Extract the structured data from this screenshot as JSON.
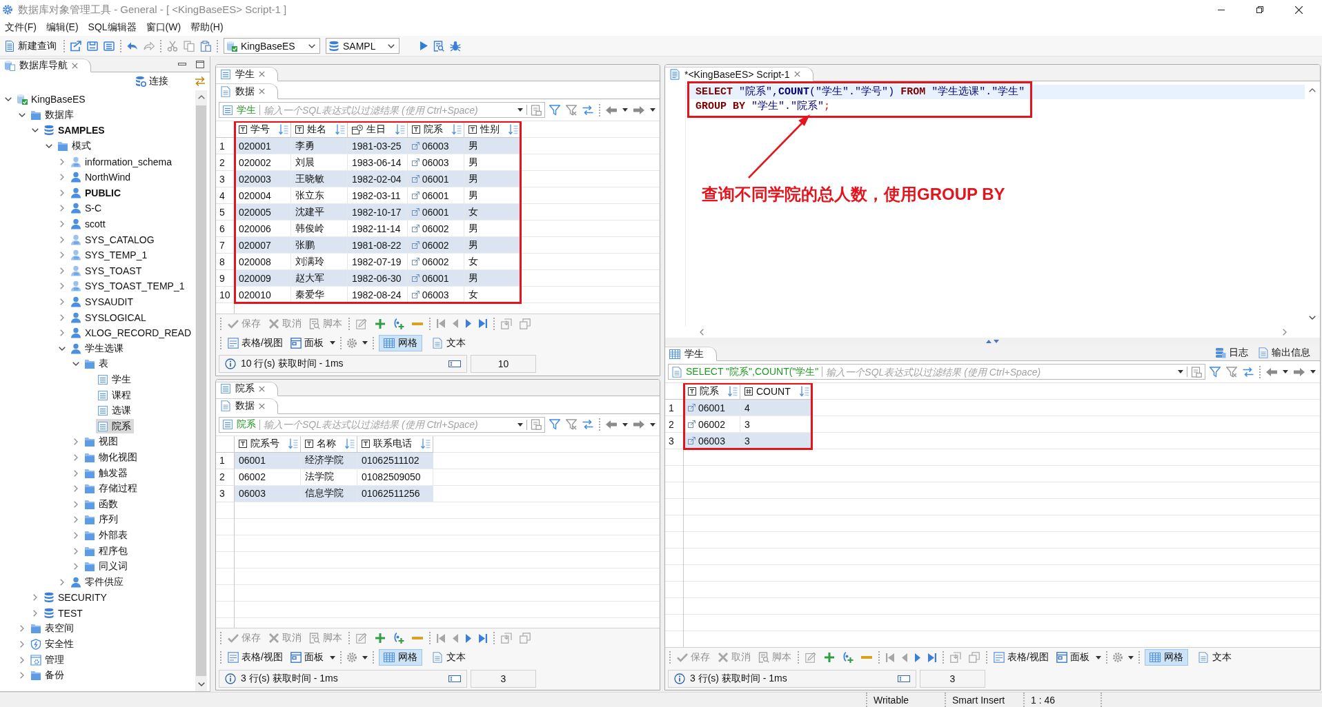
{
  "window": {
    "title": "数据库对象管理工具 - General - [ <KingBaseES> Script-1 ]"
  },
  "menu": [
    "文件(F)",
    "编辑(E)",
    "SQL编辑器",
    "窗口(W)",
    "帮助(H)"
  ],
  "toolbar": {
    "new_query": "新建查询",
    "tools": [
      [
        {
          "kind": "export",
          "disabled": false
        },
        {
          "kind": "save",
          "disabled": false
        },
        {
          "kind": "save-all",
          "disabled": false
        }
      ],
      [
        {
          "kind": "undo",
          "disabled": false
        },
        {
          "kind": "redo",
          "disabled": true
        }
      ],
      [
        {
          "kind": "cut",
          "disabled": true
        },
        {
          "kind": "copy",
          "disabled": true
        },
        {
          "kind": "paste",
          "disabled": false
        }
      ]
    ],
    "connection": "KingBaseES",
    "database": "SAMPL",
    "run": [
      {
        "kind": "execute",
        "disabled": false
      },
      {
        "kind": "explain",
        "disabled": false
      },
      {
        "kind": "debug",
        "disabled": false
      }
    ]
  },
  "navigator": {
    "tab": {
      "label": "数据库导航",
      "selected": true
    },
    "connect": "连接",
    "tree": [
      {
        "label": "KingBaseES",
        "kind": "connection",
        "selected": false,
        "current": false,
        "expanded": true,
        "children": [
          {
            "label": "数据库",
            "kind": "folder",
            "selected": false,
            "current": false,
            "expanded": true,
            "children": [
              {
                "label": "SAMPLES",
                "kind": "database",
                "selected": false,
                "current": true,
                "expanded": true,
                "children": [
                  {
                    "label": "模式",
                    "kind": "folder",
                    "selected": false,
                    "current": false,
                    "expanded": true,
                    "children": [
                      {
                        "label": "information_schema",
                        "kind": "system-schema",
                        "selected": false,
                        "current": false,
                        "expanded": false
                      },
                      {
                        "label": "NorthWind",
                        "kind": "schema",
                        "selected": false,
                        "current": false,
                        "expanded": false
                      },
                      {
                        "label": "PUBLIC",
                        "kind": "schema",
                        "selected": false,
                        "current": true,
                        "expanded": false
                      },
                      {
                        "label": "S-C",
                        "kind": "schema",
                        "selected": false,
                        "current": false,
                        "expanded": false
                      },
                      {
                        "label": "scott",
                        "kind": "schema",
                        "selected": false,
                        "current": false,
                        "expanded": false
                      },
                      {
                        "label": "SYS_CATALOG",
                        "kind": "system-schema",
                        "selected": false,
                        "current": false,
                        "expanded": false
                      },
                      {
                        "label": "SYS_TEMP_1",
                        "kind": "system-schema",
                        "selected": false,
                        "current": false,
                        "expanded": false
                      },
                      {
                        "label": "SYS_TOAST",
                        "kind": "system-schema",
                        "selected": false,
                        "current": false,
                        "expanded": false
                      },
                      {
                        "label": "SYS_TOAST_TEMP_1",
                        "kind": "system-schema",
                        "selected": false,
                        "current": false,
                        "expanded": false
                      },
                      {
                        "label": "SYSAUDIT",
                        "kind": "schema",
                        "selected": false,
                        "current": false,
                        "expanded": false
                      },
                      {
                        "label": "SYSLOGICAL",
                        "kind": "schema",
                        "selected": false,
                        "current": false,
                        "expanded": false
                      },
                      {
                        "label": "XLOG_RECORD_READ",
                        "kind": "schema",
                        "selected": false,
                        "current": false,
                        "expanded": false
                      },
                      {
                        "label": "学生选课",
                        "kind": "schema",
                        "selected": false,
                        "current": false,
                        "expanded": true,
                        "children": [
                          {
                            "label": "表",
                            "kind": "folder",
                            "selected": false,
                            "current": false,
                            "expanded": true,
                            "children": [
                              {
                                "label": "学生",
                                "kind": "table",
                                "selected": false,
                                "current": false
                              },
                              {
                                "label": "课程",
                                "kind": "table",
                                "selected": false,
                                "current": false
                              },
                              {
                                "label": "选课",
                                "kind": "table",
                                "selected": false,
                                "current": false
                              },
                              {
                                "label": "院系",
                                "kind": "table",
                                "selected": true,
                                "current": false
                              }
                            ]
                          },
                          {
                            "label": "视图",
                            "kind": "folder",
                            "selected": false,
                            "current": false,
                            "expanded": false
                          },
                          {
                            "label": "物化视图",
                            "kind": "folder",
                            "selected": false,
                            "current": false,
                            "expanded": false
                          },
                          {
                            "label": "触发器",
                            "kind": "folder",
                            "selected": false,
                            "current": false,
                            "expanded": false
                          },
                          {
                            "label": "存储过程",
                            "kind": "folder",
                            "selected": false,
                            "current": false,
                            "expanded": false
                          },
                          {
                            "label": "函数",
                            "kind": "folder",
                            "selected": false,
                            "current": false,
                            "expanded": false
                          },
                          {
                            "label": "序列",
                            "kind": "folder",
                            "selected": false,
                            "current": false,
                            "expanded": false
                          },
                          {
                            "label": "外部表",
                            "kind": "folder",
                            "selected": false,
                            "current": false,
                            "expanded": false
                          },
                          {
                            "label": "程序包",
                            "kind": "folder",
                            "selected": false,
                            "current": false,
                            "expanded": false
                          },
                          {
                            "label": "同义词",
                            "kind": "folder",
                            "selected": false,
                            "current": false,
                            "expanded": false
                          }
                        ]
                      },
                      {
                        "label": "零件供应",
                        "kind": "schema",
                        "selected": false,
                        "current": false,
                        "expanded": false
                      }
                    ]
                  }
                ]
              },
              {
                "label": "SECURITY",
                "kind": "database",
                "selected": false,
                "current": false,
                "expanded": false
              },
              {
                "label": "TEST",
                "kind": "database",
                "selected": false,
                "current": false,
                "expanded": false
              }
            ]
          },
          {
            "label": "表空间",
            "kind": "folder",
            "selected": false,
            "current": false,
            "expanded": false
          },
          {
            "label": "安全性",
            "kind": "shield",
            "selected": false,
            "current": false,
            "expanded": false
          },
          {
            "label": "管理",
            "kind": "admin",
            "selected": false,
            "current": false,
            "expanded": false
          },
          {
            "label": "备份",
            "kind": "folder",
            "selected": false,
            "current": false,
            "expanded": false
          }
        ]
      }
    ]
  },
  "editors": [
    {
      "tab": {
        "label": "学生",
        "selected": true
      },
      "subtab": {
        "label": "数据",
        "selected": true
      },
      "filter": {
        "kind": "table",
        "source": "学生",
        "placeholder": "输入一个SQL表达式以过滤结果 (使用 Ctrl+Space)"
      },
      "grid": {
        "highlighted": true,
        "columns": [
          {
            "label": "学号",
            "kind": "text"
          },
          {
            "label": "姓名",
            "kind": "text"
          },
          {
            "label": "生日",
            "kind": "date"
          },
          {
            "label": "院系",
            "kind": "text",
            "link": true
          },
          {
            "label": "性别",
            "kind": "text"
          }
        ],
        "rows": [
          {
            "number": "1",
            "cells": [
              "020001",
              "李勇",
              "1981-03-25",
              "06003",
              "男"
            ]
          },
          {
            "number": "2",
            "cells": [
              "020002",
              "刘晨",
              "1983-06-14",
              "06003",
              "男"
            ]
          },
          {
            "number": "3",
            "cells": [
              "020003",
              "王晓敏",
              "1982-02-04",
              "06001",
              "男"
            ]
          },
          {
            "number": "4",
            "cells": [
              "020004",
              "张立东",
              "1982-03-11",
              "06001",
              "男"
            ]
          },
          {
            "number": "5",
            "cells": [
              "020005",
              "沈建平",
              "1982-10-17",
              "06001",
              "女"
            ]
          },
          {
            "number": "6",
            "cells": [
              "020006",
              "韩俊岭",
              "1982-11-14",
              "06002",
              "男"
            ]
          },
          {
            "number": "7",
            "cells": [
              "020007",
              "张鹏",
              "1981-08-22",
              "06002",
              "男"
            ]
          },
          {
            "number": "8",
            "cells": [
              "020008",
              "刘满玲",
              "1982-07-19",
              "06002",
              "女"
            ]
          },
          {
            "number": "9",
            "cells": [
              "020009",
              "赵大军",
              "1982-06-30",
              "06001",
              "男"
            ]
          },
          {
            "number": "10",
            "cells": [
              "020010",
              "秦爱华",
              "1982-08-24",
              "06003",
              "女"
            ]
          }
        ]
      },
      "actions": [
        [
          {
            "kind": "save",
            "label": "保存",
            "disabled": true
          },
          {
            "kind": "cancel",
            "label": "取消",
            "disabled": true
          },
          {
            "kind": "script",
            "label": "脚本",
            "disabled": true
          }
        ],
        [
          {
            "kind": "edit",
            "disabled": true
          },
          {
            "kind": "add",
            "disabled": false
          },
          {
            "kind": "duplicate",
            "disabled": false
          },
          {
            "kind": "delete",
            "disabled": false
          }
        ],
        [
          {
            "kind": "first",
            "disabled": true
          },
          {
            "kind": "previous",
            "disabled": true
          },
          {
            "kind": "next",
            "disabled": false
          },
          {
            "kind": "last",
            "disabled": false
          }
        ],
        [
          {
            "kind": "fetch-next",
            "disabled": true
          },
          {
            "kind": "fetch-all",
            "disabled": true
          }
        ]
      ],
      "views": {
        "modes": [
          {
            "kind": "record",
            "label": "表格/视图"
          },
          {
            "kind": "panels",
            "label": "面板"
          }
        ],
        "formats": [
          {
            "kind": "grid",
            "label": "网格",
            "selected": true
          },
          {
            "kind": "text",
            "label": "文本",
            "selected": false
          }
        ]
      },
      "status": {
        "text": "10 行(s) 获取时间 - 1ms",
        "count": "10"
      }
    },
    {
      "tab": {
        "label": "院系",
        "selected": true
      },
      "subtab": {
        "label": "数据",
        "selected": true
      },
      "filter": {
        "kind": "table",
        "source": "院系",
        "placeholder": "输入一个SQL表达式以过滤结果 (使用 Ctrl+Space)"
      },
      "grid": {
        "columns": [
          {
            "label": "院系号",
            "kind": "text"
          },
          {
            "label": "名称",
            "kind": "text"
          },
          {
            "label": "联系电话",
            "kind": "text"
          }
        ],
        "rows": [
          {
            "number": "1",
            "cells": [
              "06001",
              "经济学院",
              "01062511102"
            ]
          },
          {
            "number": "2",
            "cells": [
              "06002",
              "法学院",
              "01082509050"
            ]
          },
          {
            "number": "3",
            "cells": [
              "06003",
              "信息学院",
              "01062511256"
            ]
          }
        ]
      },
      "actions": [
        [
          {
            "kind": "save",
            "label": "保存",
            "disabled": true
          },
          {
            "kind": "cancel",
            "label": "取消",
            "disabled": true
          },
          {
            "kind": "script",
            "label": "脚本",
            "disabled": true
          }
        ],
        [
          {
            "kind": "edit",
            "disabled": true
          },
          {
            "kind": "add",
            "disabled": false
          },
          {
            "kind": "duplicate",
            "disabled": false
          },
          {
            "kind": "delete",
            "disabled": false
          }
        ],
        [
          {
            "kind": "first",
            "disabled": true
          },
          {
            "kind": "previous",
            "disabled": true
          },
          {
            "kind": "next",
            "disabled": false
          },
          {
            "kind": "last",
            "disabled": false
          }
        ],
        [
          {
            "kind": "fetch-next",
            "disabled": true
          },
          {
            "kind": "fetch-all",
            "disabled": true
          }
        ]
      ],
      "views": {
        "modes": [
          {
            "kind": "record",
            "label": "表格/视图"
          },
          {
            "kind": "panels",
            "label": "面板"
          }
        ],
        "formats": [
          {
            "kind": "grid",
            "label": "网格",
            "selected": true
          },
          {
            "kind": "text",
            "label": "文本",
            "selected": false
          }
        ]
      },
      "status": {
        "text": "3 行(s) 获取时间 - 1ms",
        "count": "3"
      }
    }
  ],
  "script": {
    "tab": {
      "label": "*<KingBaseES> Script-1",
      "selected": true
    },
    "highlighted": true,
    "lines": [
      {
        "current": true,
        "tokens": [
          {
            "kind": "keyword",
            "text": "SELECT "
          },
          {
            "kind": "identifier",
            "text": "\"院系\""
          },
          {
            "kind": "symbol",
            "text": ","
          },
          {
            "kind": "function",
            "text": "COUNT"
          },
          {
            "kind": "symbol",
            "text": "("
          },
          {
            "kind": "identifier",
            "text": "\"学生\""
          },
          {
            "kind": "symbol",
            "text": "."
          },
          {
            "kind": "identifier",
            "text": "\"学号\""
          },
          {
            "kind": "symbol",
            "text": ") "
          },
          {
            "kind": "keyword",
            "text": "FROM "
          },
          {
            "kind": "identifier",
            "text": "\"学生选课\""
          },
          {
            "kind": "symbol",
            "text": "."
          },
          {
            "kind": "identifier",
            "text": "\"学生\""
          }
        ]
      },
      {
        "current": false,
        "tokens": [
          {
            "kind": "keyword",
            "text": "GROUP BY "
          },
          {
            "kind": "identifier",
            "text": "\"学生\""
          },
          {
            "kind": "symbol",
            "text": "."
          },
          {
            "kind": "identifier",
            "text": "\"院系\""
          },
          {
            "kind": "terminator",
            "text": ";"
          }
        ]
      }
    ],
    "annotation": "查询不同学院的总人数，使用GROUP BY",
    "results": {
      "tab": {
        "label": "学生",
        "selected": true
      },
      "links": [
        {
          "kind": "log",
          "label": "日志"
        },
        {
          "kind": "output",
          "label": "输出信息"
        }
      ],
      "filter": {
        "kind": "query",
        "source": "SELECT \"院系\",COUNT(\"学生\"",
        "placeholder": "输入一个SQL表达式以过滤结果 (使用 Ctrl+Space)"
      },
      "grid": {
        "highlighted": true,
        "columns": [
          {
            "label": "院系",
            "kind": "text",
            "link": true
          },
          {
            "label": "COUNT",
            "kind": "number"
          }
        ],
        "rows": [
          {
            "number": "1",
            "cells": [
              "06001",
              "4"
            ]
          },
          {
            "number": "2",
            "cells": [
              "06002",
              "3"
            ]
          },
          {
            "number": "3",
            "cells": [
              "06003",
              "3"
            ]
          }
        ]
      },
      "actions": [
        [
          {
            "kind": "save",
            "label": "保存",
            "disabled": true
          },
          {
            "kind": "cancel",
            "label": "取消",
            "disabled": true
          },
          {
            "kind": "script",
            "label": "脚本",
            "disabled": true
          }
        ],
        [
          {
            "kind": "edit",
            "disabled": true
          },
          {
            "kind": "add",
            "disabled": false
          },
          {
            "kind": "duplicate",
            "disabled": false
          },
          {
            "kind": "delete",
            "disabled": false
          }
        ],
        [
          {
            "kind": "first",
            "disabled": true
          },
          {
            "kind": "previous",
            "disabled": true
          },
          {
            "kind": "next",
            "disabled": false
          },
          {
            "kind": "last",
            "disabled": false
          }
        ],
        [
          {
            "kind": "fetch-next",
            "disabled": true
          },
          {
            "kind": "fetch-all",
            "disabled": true
          }
        ]
      ],
      "views": {
        "modes": [
          {
            "kind": "record",
            "label": "表格/视图"
          },
          {
            "kind": "panels",
            "label": "面板"
          }
        ],
        "formats": [
          {
            "kind": "grid",
            "label": "网格",
            "selected": true
          },
          {
            "kind": "text",
            "label": "文本",
            "selected": false
          }
        ]
      },
      "status": {
        "text": "3 行(s) 获取时间 - 1ms",
        "count": "3"
      }
    }
  },
  "status_bar": [
    "Writable",
    "Smart Insert",
    "1 : 46"
  ]
}
